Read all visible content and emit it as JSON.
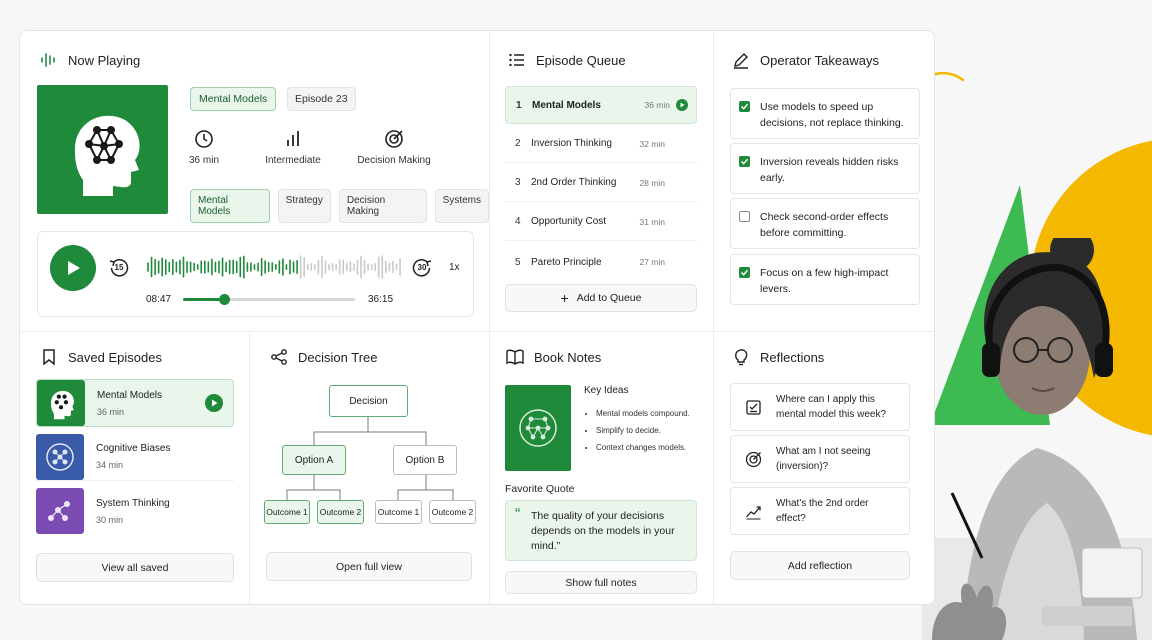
{
  "now_playing": {
    "title": "Now Playing",
    "category_chip": "Mental Models",
    "episode_chip": "Episode 23",
    "stats": [
      {
        "icon": "clock-icon",
        "label": "36 min"
      },
      {
        "icon": "bar-chart-icon",
        "label": "Intermediate"
      },
      {
        "icon": "target-icon",
        "label": "Decision Making"
      }
    ],
    "tags": [
      "Mental Models",
      "Strategy",
      "Decision Making",
      "Systems"
    ],
    "player": {
      "elapsed": "08:47",
      "total": "36:15",
      "progress": 0.24,
      "speed": "1x",
      "skip_back": "15",
      "skip_forward": "30"
    }
  },
  "queue": {
    "title": "Episode Queue",
    "items": [
      {
        "num": "1",
        "name": "Mental Models",
        "dur": "36 min",
        "active": true
      },
      {
        "num": "2",
        "name": "Inversion Thinking",
        "dur": "32 min"
      },
      {
        "num": "3",
        "name": "2nd Order Thinking",
        "dur": "28 min"
      },
      {
        "num": "4",
        "name": "Opportunity Cost",
        "dur": "31 min"
      },
      {
        "num": "5",
        "name": "Pareto Principle",
        "dur": "27 min"
      }
    ],
    "add_label": "Add to Queue"
  },
  "takeaways": {
    "title": "Operator Takeaways",
    "items": [
      {
        "text": "Use models to speed up decisions, not replace thinking.",
        "checked": true
      },
      {
        "text": "Inversion reveals hidden risks early.",
        "checked": true
      },
      {
        "text": "Check second-order effects before committing.",
        "checked": false
      },
      {
        "text": "Focus on a few high-impact levers.",
        "checked": true
      }
    ]
  },
  "saved": {
    "title": "Saved Episodes",
    "items": [
      {
        "name": "Mental Models",
        "dur": "36 min",
        "color": "#1f8a3a"
      },
      {
        "name": "Cognitive Biases",
        "dur": "34 min",
        "color": "#3a5ba8"
      },
      {
        "name": "System Thinking",
        "dur": "30 min",
        "color": "#7a4bb0"
      }
    ],
    "view_all": "View all saved"
  },
  "tree": {
    "title": "Decision Tree",
    "root": "Decision",
    "a": "Option A",
    "b": "Option B",
    "o1": "Outcome 1",
    "o2": "Outcome 2",
    "o3": "Outcome 1",
    "o4": "Outcome 2",
    "open": "Open full view"
  },
  "notes": {
    "title": "Book Notes",
    "key_ideas": "Key Ideas",
    "ideas": [
      "Mental models compound.",
      "Simplify to decide.",
      "Context changes models."
    ],
    "fav_label": "Favorite Quote",
    "quote": "The quality of your decisions depends on the models in your mind.”",
    "show": "Show full notes"
  },
  "reflections": {
    "title": "Reflections",
    "items": [
      {
        "icon": "checklist-icon",
        "text": "Where can I apply this mental model this week?"
      },
      {
        "icon": "target-icon",
        "text": "What am I not seeing (inversion)?"
      },
      {
        "icon": "trend-icon",
        "text": "What's the 2nd order effect?"
      }
    ],
    "add": "Add reflection"
  },
  "colors": {
    "accent": "#1f8a3a",
    "yellow": "#f5b800",
    "green_shape": "#3dba52"
  }
}
